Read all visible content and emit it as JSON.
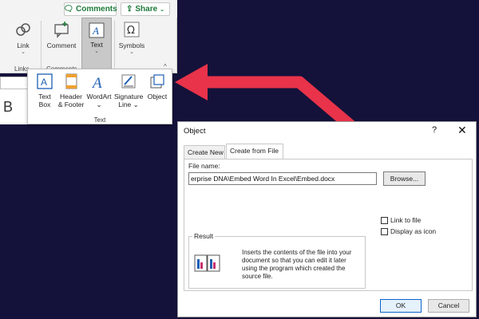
{
  "ribbon": {
    "comments_btn": "Comments",
    "share_btn": "Share",
    "link_label": "Link",
    "comment_label": "Comment",
    "text_label": "Text",
    "symbols_label": "Symbols",
    "group_links": "Links",
    "group_comments": "Comments"
  },
  "sheet_fragment": "B",
  "gallery": {
    "items": [
      {
        "line1": "Text",
        "line2": "Box"
      },
      {
        "line1": "Header",
        "line2": "& Footer"
      },
      {
        "line1": "WordArt",
        "line2": "⌄"
      },
      {
        "line1": "Signature",
        "line2": "Line ⌄"
      },
      {
        "line1": "Object",
        "line2": ""
      }
    ],
    "group_label": "Text"
  },
  "dialog": {
    "title": "Object",
    "help": "?",
    "close": "✕",
    "tabs": [
      "Create New",
      "Create from File"
    ],
    "file_name_label": "File name:",
    "file_name_value": "erprise DNA\\Embed Word In Excel\\Embed.docx",
    "browse": "Browse...",
    "link_to_file": "Link to file",
    "display_as_icon": "Display as icon",
    "result_label": "Result",
    "result_text": "Inserts the contents of the file into your document so that you can edit it later using the program which created the source file.",
    "ok": "OK",
    "cancel": "Cancel"
  },
  "colors": {
    "background": "#14123a",
    "arrow": "#e8334a",
    "share_green": "#1e7a3a",
    "ok_border": "#0a64c8"
  }
}
